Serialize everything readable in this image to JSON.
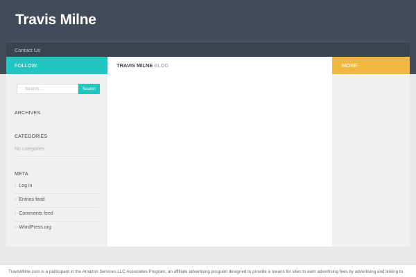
{
  "site": {
    "title": "Travis Milne"
  },
  "nav": {
    "contact_label": "Contact Us"
  },
  "left_sidebar": {
    "follow_label": "FOLLOW:",
    "search": {
      "placeholder": "Search ...",
      "button_label": "Search"
    },
    "archives_title": "ARCHIVES",
    "categories_title": "CATEGORIES",
    "categories_empty": "No categories",
    "meta_title": "META",
    "meta_items": [
      {
        "label": "Log in"
      },
      {
        "label": "Entries feed"
      },
      {
        "label": "Comments feed"
      },
      {
        "label": "WordPress.org"
      }
    ],
    "bullet": "›"
  },
  "main": {
    "name": "TRAVIS MILNE",
    "suffix": "BLOG"
  },
  "right_sidebar": {
    "more_label": "MORE"
  },
  "footer": {
    "text": "TravisMilne.com is a participant in the Amazon Services LLC Associates Program, an affiliate advertising program designed to provide a means for sites to earn advertising fees by advertising and linking to"
  },
  "colors": {
    "header": "#434b5a",
    "teal": "#1fc7c0",
    "orange": "#efb93f",
    "background": "#e9e9e9"
  }
}
